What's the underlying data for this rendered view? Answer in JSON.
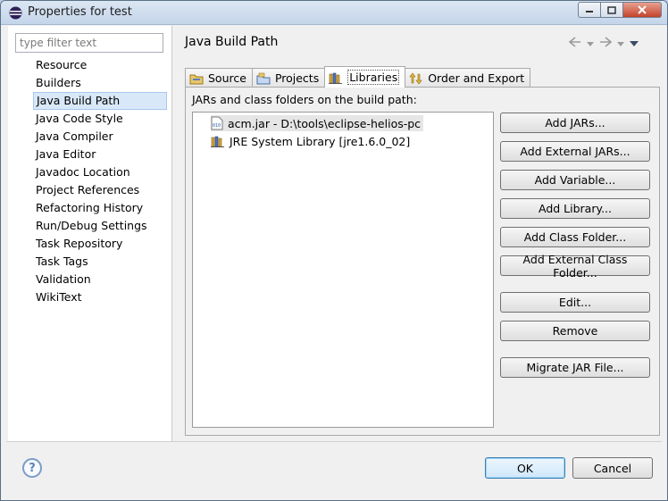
{
  "window": {
    "title": "Properties for test"
  },
  "filter": {
    "placeholder": "type filter text"
  },
  "nav": {
    "items": [
      {
        "label": "Resource"
      },
      {
        "label": "Builders"
      },
      {
        "label": "Java Build Path",
        "selected": true
      },
      {
        "label": "Java Code Style"
      },
      {
        "label": "Java Compiler"
      },
      {
        "label": "Java Editor"
      },
      {
        "label": "Javadoc Location"
      },
      {
        "label": "Project References"
      },
      {
        "label": "Refactoring History"
      },
      {
        "label": "Run/Debug Settings"
      },
      {
        "label": "Task Repository"
      },
      {
        "label": "Task Tags"
      },
      {
        "label": "Validation"
      },
      {
        "label": "WikiText"
      }
    ]
  },
  "page": {
    "title": "Java Build Path"
  },
  "tabs": [
    {
      "label": "Source",
      "icon": "source-folder-icon"
    },
    {
      "label": "Projects",
      "icon": "projects-folder-icon"
    },
    {
      "label": "Libraries",
      "icon": "libraries-icon",
      "active": true
    },
    {
      "label": "Order and Export",
      "icon": "order-export-icon"
    }
  ],
  "libraries": {
    "heading": "JARs and class folders on the build path:",
    "entries": [
      {
        "label": "acm.jar - D:\\tools\\eclipse-helios-pc",
        "icon": "jar-file-icon",
        "selected": true
      },
      {
        "label": "JRE System Library [jre1.6.0_02]",
        "icon": "library-icon"
      }
    ]
  },
  "buttons": {
    "add_jars": "Add JARs...",
    "add_external_jars": "Add External JARs...",
    "add_variable": "Add Variable...",
    "add_library": "Add Library...",
    "add_class_folder": "Add Class Folder...",
    "add_external_class_folder": "Add External Class Folder...",
    "edit": "Edit...",
    "remove": "Remove",
    "migrate_jar": "Migrate JAR File..."
  },
  "footer": {
    "help": "?",
    "ok": "OK",
    "cancel": "Cancel"
  },
  "colors": {
    "titlebar": "#c4d5ea",
    "selection": "#d9e8f8",
    "ok_border": "#3c7fb1"
  }
}
